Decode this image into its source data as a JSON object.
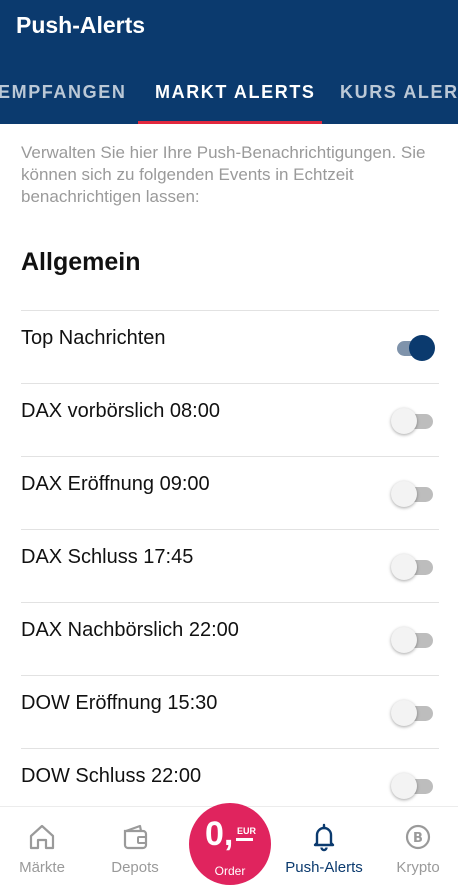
{
  "header": {
    "title": "Push-Alerts"
  },
  "tabs": [
    {
      "label": "EMPFANGEN",
      "active": false
    },
    {
      "label": "MARKT ALERTS",
      "active": true
    },
    {
      "label": "KURS ALERTS",
      "active": false
    }
  ],
  "intro": "Verwalten Sie hier Ihre Push-Benachrichtigungen. Sie können sich zu folgenden Events in Echtzeit benachrichtigen lassen:",
  "section_title": "Allgemein",
  "alerts": [
    {
      "label": "Top Nachrichten",
      "enabled": true
    },
    {
      "label": "DAX vorbörslich 08:00",
      "enabled": false
    },
    {
      "label": "DAX Eröffnung 09:00",
      "enabled": false
    },
    {
      "label": "DAX Schluss 17:45",
      "enabled": false
    },
    {
      "label": "DAX Nachbörslich 22:00",
      "enabled": false
    },
    {
      "label": "DOW Eröffnung 15:30",
      "enabled": false
    },
    {
      "label": "DOW Schluss 22:00",
      "enabled": false
    }
  ],
  "nav": {
    "items": [
      {
        "label": "Märkte",
        "icon": "home-icon",
        "active": false
      },
      {
        "label": "Depots",
        "icon": "wallet-icon",
        "active": false
      },
      {
        "label": "Push-Alerts",
        "icon": "bell-icon",
        "active": true
      },
      {
        "label": "Krypto",
        "icon": "bitcoin-icon",
        "active": false
      }
    ],
    "order": {
      "big": "0,",
      "currency": "EUR",
      "label": "Order"
    }
  },
  "colors": {
    "primary": "#0b3a6e",
    "accent": "#e2283e",
    "order": "#e0245e",
    "muted": "#9a9a9a"
  }
}
